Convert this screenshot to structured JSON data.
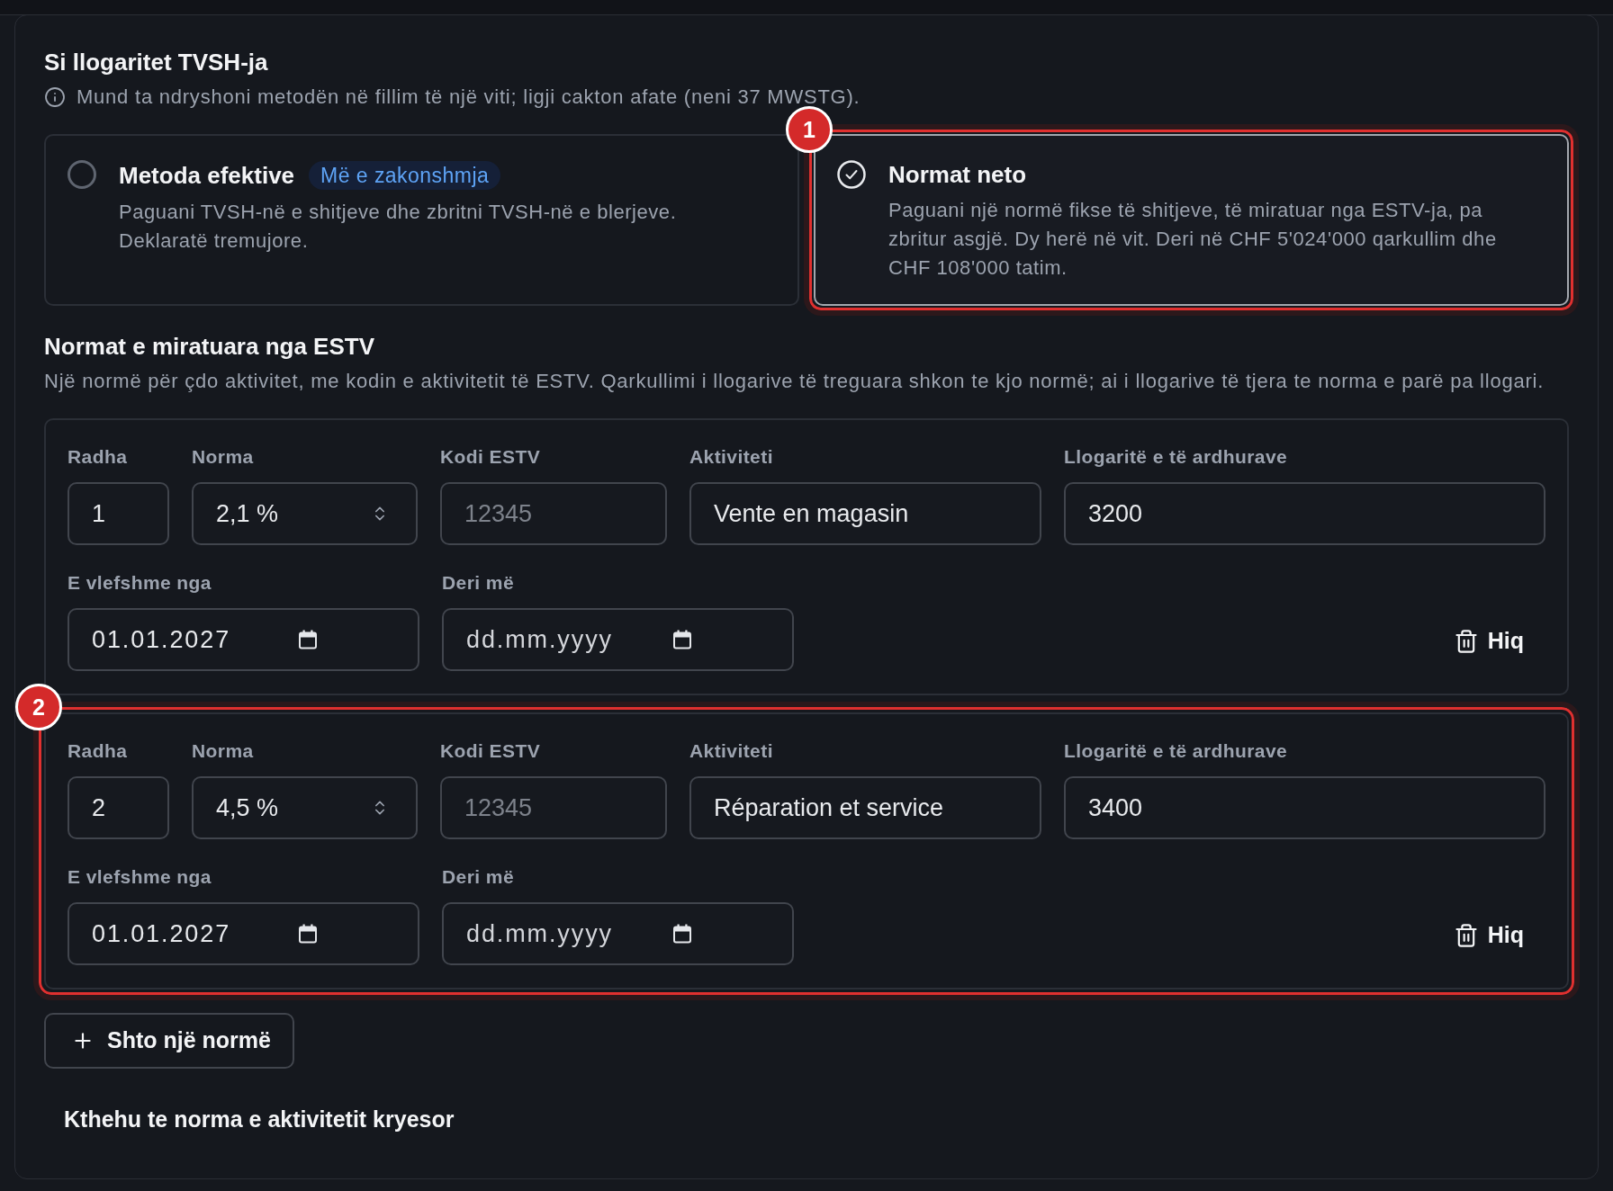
{
  "method": {
    "title": "Si llogaritet TVSH-ja",
    "info": "Mund ta ndryshoni metodën në fillim të një viti; ligji cakton afate (neni 37 MWSTG).",
    "options": [
      {
        "title": "Metoda efektive",
        "tag": "Më e zakonshmja",
        "description": "Paguani TVSH-në e shitjeve dhe zbritni TVSH-në e blerjeve. Deklaratë tremujore.",
        "selected": false
      },
      {
        "title": "Normat neto",
        "description": "Paguani një normë fikse të shitjeve, të miratuar nga ESTV-ja, pa zbritur asgjë. Dy herë në vit. Deri në CHF 5'024'000 qarkullim dhe CHF 108'000 tatim.",
        "selected": true,
        "callout": "1"
      }
    ]
  },
  "rates": {
    "title": "Normat e miratuara nga ESTV",
    "description": "Një normë për çdo aktivitet, me kodin e aktivitetit të ESTV. Qarkullimi i llogarive të treguara shkon te kjo normë; ai i llogarive të tjera te norma e parë pa llogari.",
    "rows": [
      {
        "fields": [
          {
            "label": "Radha",
            "kind": "text",
            "value": "1"
          },
          {
            "label": "Norma",
            "kind": "select",
            "value": "2,1 %"
          },
          {
            "label": "Kodi ESTV",
            "kind": "text",
            "placeholder": "12345"
          },
          {
            "label": "Aktiviteti",
            "kind": "text",
            "value": "Vente en magasin"
          },
          {
            "label": "Llogaritë e të ardhurave",
            "kind": "text",
            "value": "3200"
          },
          {
            "label": "E vlefshme nga",
            "kind": "date",
            "value": "01.01.2027"
          },
          {
            "label": "Deri më",
            "kind": "date",
            "placeholder": "dd.mm.yyyy"
          }
        ],
        "remove_button": "Hiq"
      },
      {
        "fields": [
          {
            "label": "Radha",
            "kind": "text",
            "value": "2"
          },
          {
            "label": "Norma",
            "kind": "select",
            "value": "4,5 %"
          },
          {
            "label": "Kodi ESTV",
            "kind": "text",
            "placeholder": "12345"
          },
          {
            "label": "Aktiviteti",
            "kind": "text",
            "value": "Réparation et service"
          },
          {
            "label": "Llogaritë e të ardhurave",
            "kind": "text",
            "value": "3400"
          },
          {
            "label": "E vlefshme nga",
            "kind": "date",
            "value": "01.01.2027"
          },
          {
            "label": "Deri më",
            "kind": "date",
            "placeholder": "dd.mm.yyyy"
          }
        ],
        "remove_button": "Hiq",
        "callout": "2"
      }
    ],
    "add_button": "Shto një normë",
    "reset_link": "Kthehu te norma e aktivitetit kryesor"
  }
}
